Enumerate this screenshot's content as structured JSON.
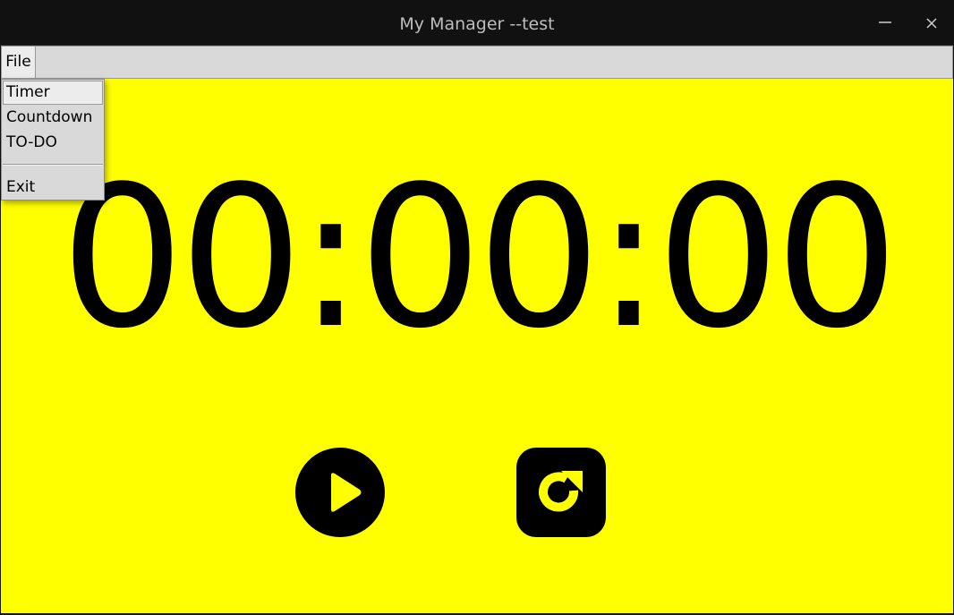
{
  "window": {
    "title": "My Manager --test",
    "controls": {
      "minimize_icon": "minimize-icon",
      "close_icon": "close-icon"
    }
  },
  "menubar": {
    "file_label": "File"
  },
  "file_menu": {
    "items": [
      {
        "label": "Timer",
        "highlighted": true
      },
      {
        "label": "Countdown",
        "highlighted": false
      },
      {
        "label": "TO-DO",
        "highlighted": false
      },
      {
        "label": "Exit",
        "highlighted": false
      }
    ]
  },
  "timer": {
    "display": "00:00:00",
    "background_color": "#ffff00",
    "text_color": "#000000"
  },
  "controls": {
    "play_icon": "play-icon",
    "reset_icon": "reset-icon"
  }
}
